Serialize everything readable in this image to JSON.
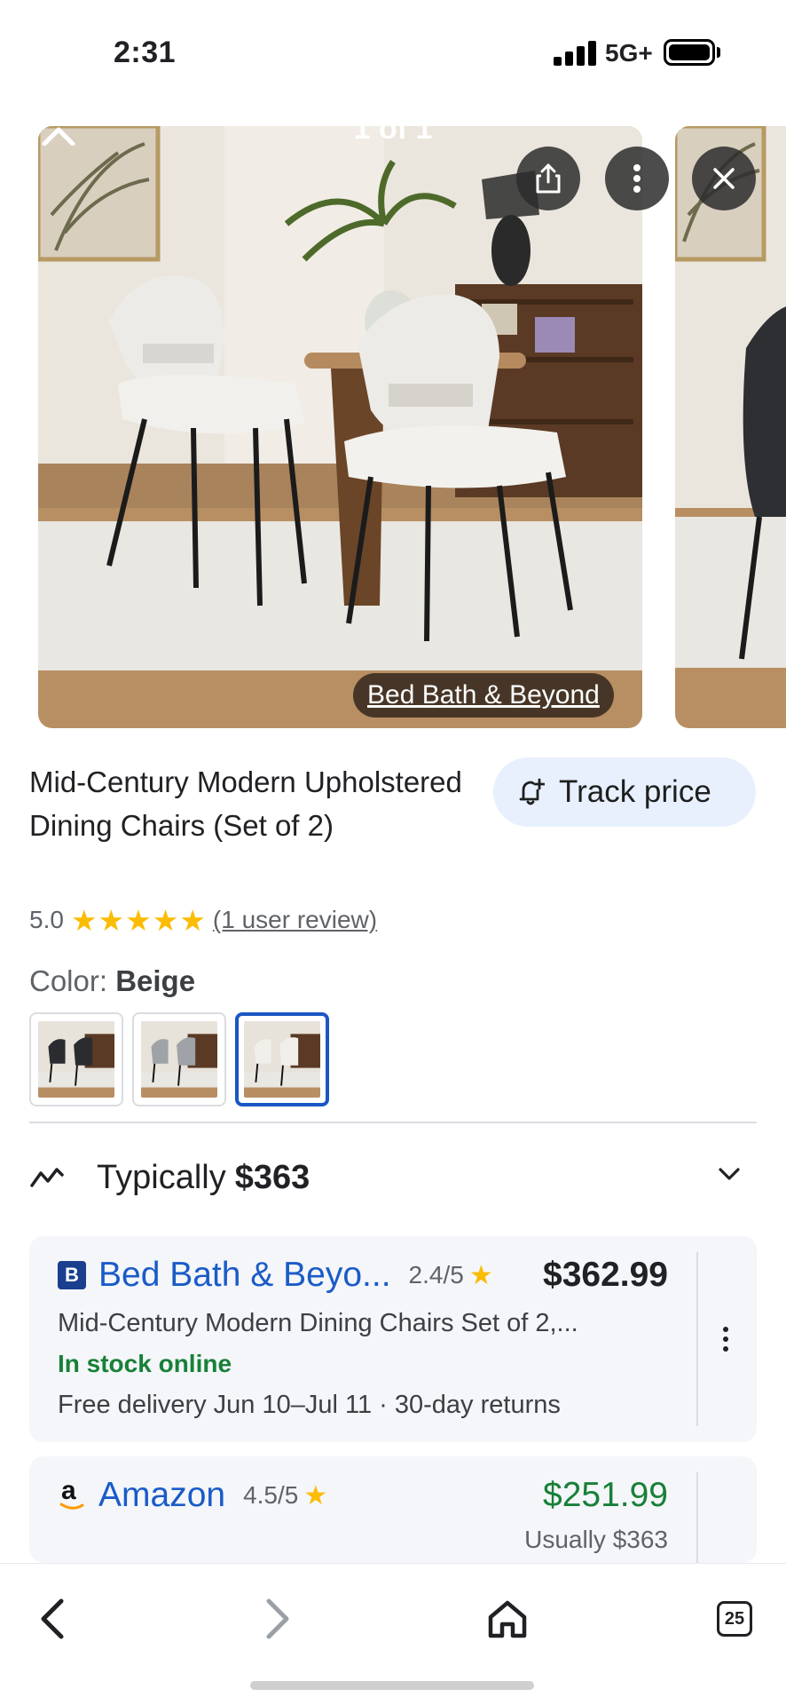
{
  "status_bar": {
    "time": "2:31",
    "network": "5G+",
    "icons": [
      "cellular-signal-icon",
      "battery-icon"
    ]
  },
  "viewer": {
    "counter": "1 of 1",
    "source_label": "Bed Bath & Beyond",
    "icons": [
      "chevron-up-icon",
      "share-icon",
      "more-vert-icon",
      "close-icon"
    ]
  },
  "product": {
    "title": "Mid-Century Modern Upholstered Dining Chairs (Set of 2)",
    "track_price_label": "Track price",
    "rating_value": "5.0",
    "stars": 5,
    "review_link": "(1 user review)",
    "color_label": "Color: ",
    "color_value": "Beige",
    "swatches_count": 3,
    "selected_swatch": 3
  },
  "price_summary": {
    "label": "Typically",
    "price": "$363"
  },
  "offers": [
    {
      "merchant": "Bed Bath & Beyo...",
      "merchant_badge": "B",
      "rating": "2.4/5",
      "price": "$362.99",
      "description": "Mid-Century Modern Dining Chairs Set of 2,...",
      "stock": "In stock online",
      "delivery": "Free delivery Jun 10–Jul 11 · 30-day returns"
    },
    {
      "merchant": "Amazon",
      "merchant_badge": "a",
      "rating": "4.5/5",
      "price": "$251.99",
      "usual_price": "Usually $363"
    }
  ],
  "bottom_nav": {
    "tab_count": "25",
    "icons": [
      "back-arrow-icon",
      "forward-arrow-icon",
      "home-icon",
      "tabs-icon"
    ]
  },
  "colors": {
    "link_blue": "#1a5bc8",
    "sale_green": "#188038",
    "star_yellow": "#fbbc04",
    "chip_bg": "#e8f0fe"
  }
}
